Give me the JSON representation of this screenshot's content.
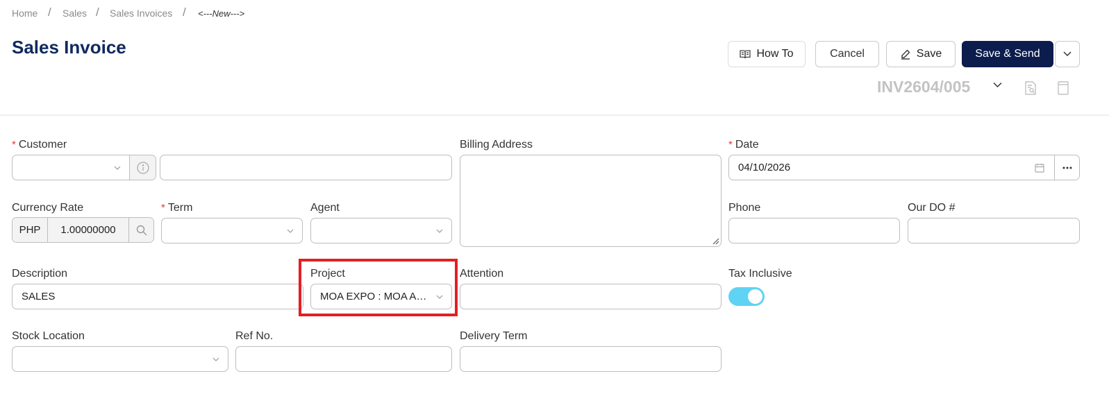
{
  "breadcrumb": {
    "home": "Home",
    "sales": "Sales",
    "invoices": "Sales Invoices",
    "current": "<---New--->"
  },
  "page": {
    "title": "Sales Invoice"
  },
  "toolbar": {
    "howto": "How To",
    "cancel": "Cancel",
    "save": "Save",
    "save_send": "Save & Send"
  },
  "invoice": {
    "number": "INV2604/005"
  },
  "form": {
    "customer": {
      "label": "Customer",
      "code": "",
      "name": ""
    },
    "billing_address": {
      "label": "Billing Address",
      "value": ""
    },
    "date": {
      "label": "Date",
      "value": "04/10/2026"
    },
    "currency_rate": {
      "label": "Currency Rate",
      "currency": "PHP",
      "rate": "1.00000000"
    },
    "term": {
      "label": "Term",
      "value": ""
    },
    "agent": {
      "label": "Agent",
      "value": ""
    },
    "phone": {
      "label": "Phone",
      "value": ""
    },
    "our_do": {
      "label": "Our DO #",
      "value": ""
    },
    "description": {
      "label": "Description",
      "value": "SALES"
    },
    "project": {
      "label": "Project",
      "value": "MOA EXPO : MOA AR..."
    },
    "attention": {
      "label": "Attention",
      "value": ""
    },
    "tax_inclusive": {
      "label": "Tax Inclusive",
      "enabled": true
    },
    "stock_location": {
      "label": "Stock Location",
      "value": ""
    },
    "ref_no": {
      "label": "Ref No.",
      "value": ""
    },
    "delivery_term": {
      "label": "Delivery Term",
      "value": ""
    },
    "required_mark": "*"
  },
  "colors": {
    "primary": "#0b1c4d",
    "title": "#0f2a5f",
    "toggle": "#5fd3f3",
    "highlight": "#e31e24",
    "required": "#e53935"
  }
}
